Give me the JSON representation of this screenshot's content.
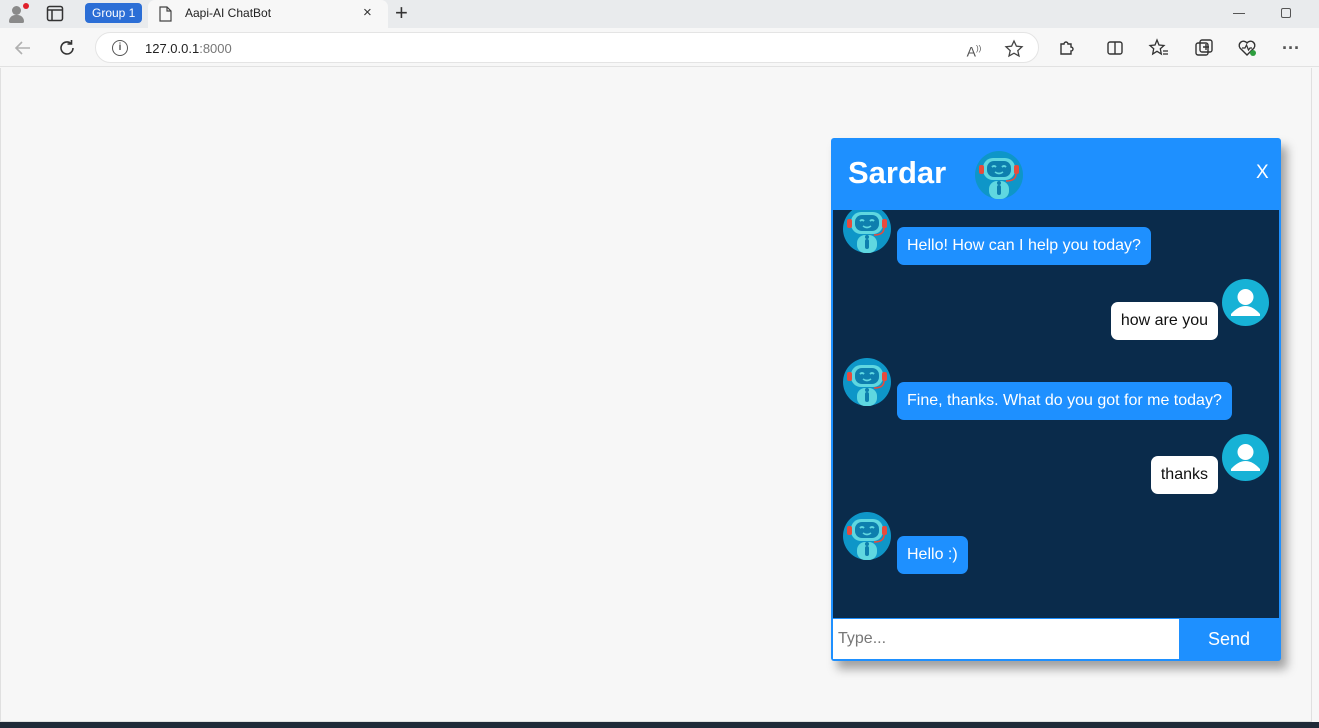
{
  "browser": {
    "group_label": "Group 1",
    "tab_title": "Aapi-AI ChatBot",
    "tab_close": "×",
    "new_tab": "+",
    "url_host": "127.0.0.1",
    "url_port": ":8000",
    "icons": [
      "profile-icon",
      "tab-actions-icon",
      "page-icon",
      "back-icon",
      "refresh-icon",
      "info-icon",
      "read-aloud-icon",
      "favorite-star-icon",
      "extensions-icon",
      "split-screen-icon",
      "favorites-icon",
      "collections-icon",
      "browser-essentials-icon",
      "more-icon"
    ]
  },
  "chat": {
    "name": "Sardar",
    "close_label": "X",
    "messages": [
      {
        "from": "bot",
        "text": "Hello! How can I help you today?"
      },
      {
        "from": "user",
        "text": "how are you"
      },
      {
        "from": "bot",
        "text": "Fine, thanks. What do you got for me today?"
      },
      {
        "from": "user",
        "text": "thanks"
      },
      {
        "from": "bot",
        "text": "Hello :)"
      }
    ],
    "input_placeholder": "Type...",
    "send_label": "Send",
    "colors": {
      "accent": "#1e90ff",
      "body_bg": "#0a2b4b",
      "user_bubble": "#ffffff",
      "bot_robot": "#3ec7d6",
      "user_avatar": "#17b2d6"
    }
  }
}
